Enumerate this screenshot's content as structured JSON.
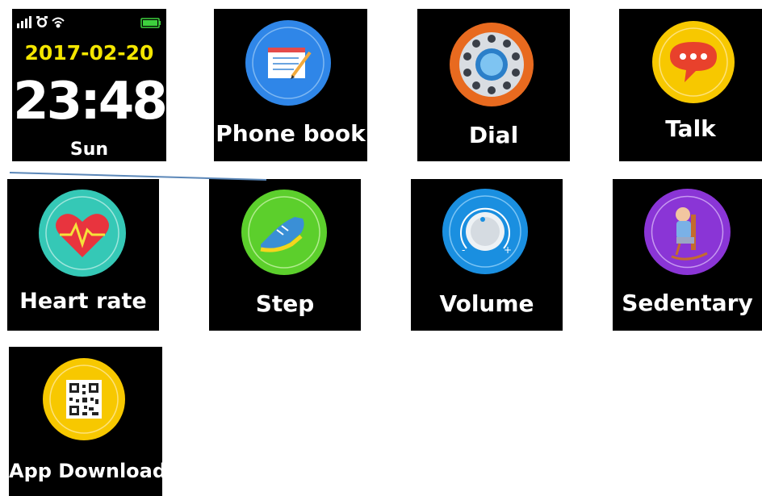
{
  "clock": {
    "date": "2017-02-20",
    "time": "23:48",
    "day": "Sun"
  },
  "status_icons": [
    "signal-icon",
    "alarm-clock-icon",
    "wifi-icon",
    "battery-icon"
  ],
  "apps": [
    {
      "id": "phone-book",
      "label": "Phone book",
      "icon": "phone-book-icon",
      "ring_color": "#2f86e8"
    },
    {
      "id": "dial",
      "label": "Dial",
      "icon": "rotary-dial-icon",
      "ring_color": "#e86a1f"
    },
    {
      "id": "talk",
      "label": "Talk",
      "icon": "chat-bubble-icon",
      "ring_color": "#f7c800"
    },
    {
      "id": "heart-rate",
      "label": "Heart rate",
      "icon": "heart-pulse-icon",
      "ring_color": "#35c8b6"
    },
    {
      "id": "step",
      "label": "Step",
      "icon": "sneaker-icon",
      "ring_color": "#5ccf2c"
    },
    {
      "id": "volume",
      "label": "Volume",
      "icon": "volume-knob-icon",
      "ring_color": "#1a8fe0"
    },
    {
      "id": "sedentary",
      "label": "Sedentary",
      "icon": "rocking-chair-icon",
      "ring_color": "#8a35d6"
    },
    {
      "id": "app-download",
      "label": "App Download",
      "icon": "qr-code-icon",
      "ring_color": "#f7c800"
    }
  ]
}
